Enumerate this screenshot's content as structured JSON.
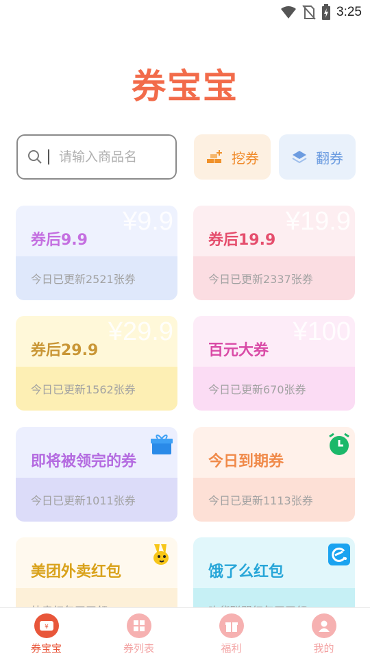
{
  "status_bar": {
    "time": "3:25"
  },
  "app": {
    "title": "券宝宝"
  },
  "search": {
    "placeholder": "请输入商品名",
    "value": ""
  },
  "actions": {
    "dig_label": "挖券",
    "flip_label": "翻券"
  },
  "cards": [
    {
      "title": "券后9.9",
      "watermark": "¥9.9",
      "subtitle": "今日已更新2521张券",
      "title_color": "#c46fe0",
      "top_color": "#eef2fe",
      "bottom_color": "#dfe8fb"
    },
    {
      "title": "券后19.9",
      "watermark": "¥19.9",
      "subtitle": "今日已更新2337张券",
      "title_color": "#e54e6d",
      "top_color": "#fdeef1",
      "bottom_color": "#fbdde2"
    },
    {
      "title": "券后29.9",
      "watermark": "¥29.9",
      "subtitle": "今日已更新1562张券",
      "title_color": "#c99636",
      "top_color": "#fff8d9",
      "bottom_color": "#fdefb4"
    },
    {
      "title": "百元大券",
      "watermark": "¥100",
      "subtitle": "今日已更新670张券",
      "title_color": "#d94aa6",
      "top_color": "#fdecf8",
      "bottom_color": "#fbdcf4"
    },
    {
      "title": "即将被领完的券",
      "watermark": "",
      "subtitle": "今日已更新1011张券",
      "title_color": "#b46be0",
      "top_color": "#eceffe",
      "bottom_color": "#dcdcf9",
      "icon": "gift-icon"
    },
    {
      "title": "今日到期券",
      "watermark": "",
      "subtitle": "今日已更新1113张券",
      "title_color": "#f08a4a",
      "top_color": "#fff1ea",
      "bottom_color": "#fde0d6",
      "icon": "alarm-clock-icon"
    },
    {
      "title": "美团外卖红包",
      "watermark": "",
      "subtitle": "外卖红包天天领",
      "title_color": "#d9a21b",
      "top_color": "#fff9ee",
      "bottom_color": "#fdf0d8",
      "icon": "meituan-icon"
    },
    {
      "title": "饿了么红包",
      "watermark": "",
      "subtitle": "吃货联盟红包天天领",
      "title_color": "#27a6d8",
      "top_color": "#e1f7fb",
      "bottom_color": "#c6f0f5",
      "icon": "eleme-icon"
    }
  ],
  "tabs": [
    {
      "label": "券宝宝",
      "icon": "coupon-icon",
      "active": true
    },
    {
      "label": "券列表",
      "icon": "grid-icon",
      "active": false
    },
    {
      "label": "福利",
      "icon": "gift-box-icon",
      "active": false
    },
    {
      "label": "我的",
      "icon": "user-icon",
      "active": false
    }
  ],
  "colors": {
    "accent": "#f26b4a",
    "tab_inactive": "#f3a2a2"
  }
}
